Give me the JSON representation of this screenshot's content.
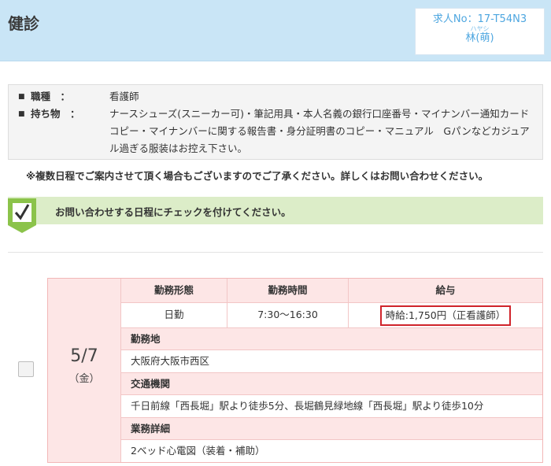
{
  "header": {
    "title": "健診",
    "job_no": "求人No：17-T54N3",
    "furigana": "ハヤシ",
    "name": "林(萌)"
  },
  "info": {
    "job_type_label": "職種　：",
    "job_type_value": "看護師",
    "items_label": "持ち物　：",
    "items_value": "ナースシューズ(スニーカー可)・筆記用具・本人名義の銀行口座番号・マイナンバー通知カードコピー・マイナンバーに関する報告書・身分証明書のコピー・マニュアル　Gパンなどカジュアル過ぎる服装はお控え下さい。"
  },
  "notice": "※複数日程でご案内させて頂く場合もございますのでご了承ください。詳しくはお問い合わせください。",
  "check_banner": "お問い合わせする日程にチェックを付けてください。",
  "schedule": {
    "date": "5/7",
    "day_of_week": "（金）",
    "col_headers": [
      "勤務形態",
      "勤務時間",
      "給与"
    ],
    "work_type": "日勤",
    "work_hours": "7:30～16:30",
    "salary": "時給:1,750円（正看護師）",
    "location_label": "勤務地",
    "location": "大阪府大阪市西区",
    "transport_label": "交通機関",
    "transport": "千日前線「西長堀」駅より徒歩5分、長堀鶴見緑地線「西長堀」駅より徒歩10分",
    "details_label": "業務詳細",
    "details": "2ベッド心電図（装着・補助）"
  },
  "colors": {
    "header_bg": "#c9e5f6",
    "accent_blue": "#4da6e0",
    "banner_green": "#dcedc8",
    "check_green": "#8bc34a",
    "pink_bg": "#fde6e6",
    "highlight_red": "#d0242b"
  },
  "icons": {
    "check_banner_icon": "checkmark-icon"
  }
}
